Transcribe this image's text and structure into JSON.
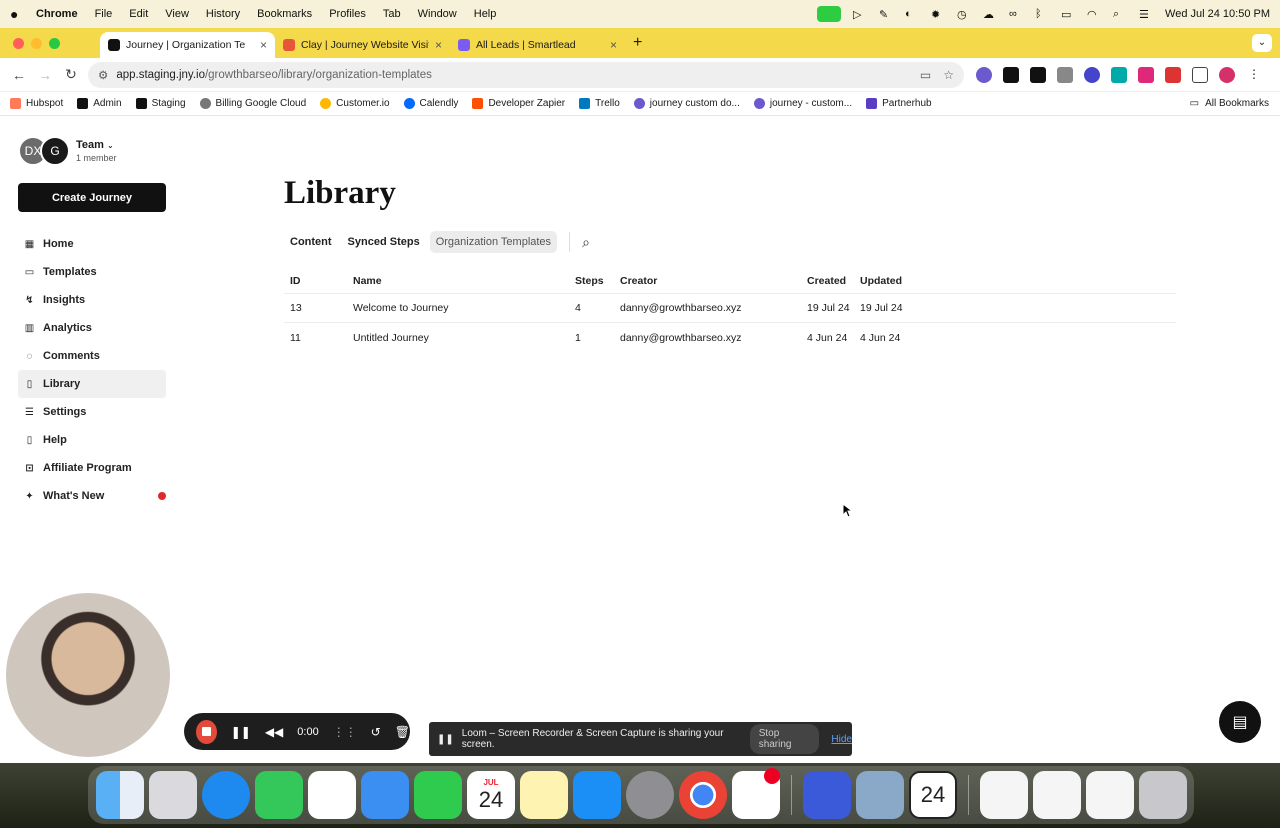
{
  "menubar": {
    "app": "Chrome",
    "items": [
      "File",
      "Edit",
      "View",
      "History",
      "Bookmarks",
      "Profiles",
      "Tab",
      "Window",
      "Help"
    ],
    "clock": "Wed Jul 24  10:50 PM"
  },
  "tabs": [
    {
      "title": "Journey | Organization Te",
      "color": "#111111"
    },
    {
      "title": "Clay | Journey Website Visitor",
      "color": "#e8563a"
    },
    {
      "title": "All Leads | Smartlead",
      "color": "#7b5cf0"
    }
  ],
  "address": {
    "host": "app.staging.jny.io",
    "path": "/growthbarseo/library/organization-templates"
  },
  "bookmarks": [
    {
      "label": "Hubspot",
      "color": "#ff7a59"
    },
    {
      "label": "Admin",
      "color": "#111111"
    },
    {
      "label": "Staging",
      "color": "#111111"
    },
    {
      "label": "Billing Google Cloud",
      "color": "#777777"
    },
    {
      "label": "Customer.io",
      "color": "#ffb800"
    },
    {
      "label": "Calendly",
      "color": "#006bff"
    },
    {
      "label": "Developer Zapier",
      "color": "#ff4f00"
    },
    {
      "label": "Trello",
      "color": "#0079bf"
    },
    {
      "label": "journey custom do...",
      "color": "#6a5acd"
    },
    {
      "label": "journey - custom...",
      "color": "#6a5acd"
    },
    {
      "label": "Partnerhub",
      "color": "#5b3cc4"
    }
  ],
  "all_bookmarks": "All Bookmarks",
  "team": {
    "avatar1": "DX",
    "avatar2": "G",
    "name": "Team",
    "members": "1 member"
  },
  "create_button": "Create Journey",
  "nav": [
    {
      "label": "Home",
      "icon": "grid-icon",
      "glyph": "▦"
    },
    {
      "label": "Templates",
      "icon": "templates-icon",
      "glyph": "▭"
    },
    {
      "label": "Insights",
      "icon": "insights-icon",
      "glyph": "↯"
    },
    {
      "label": "Analytics",
      "icon": "analytics-icon",
      "glyph": "▥"
    },
    {
      "label": "Comments",
      "icon": "comment-icon",
      "glyph": "◌"
    },
    {
      "label": "Library",
      "icon": "book-icon",
      "glyph": "▯"
    },
    {
      "label": "Settings",
      "icon": "settings-icon",
      "glyph": "☰"
    },
    {
      "label": "Help",
      "icon": "help-icon",
      "glyph": "▯"
    },
    {
      "label": "Affiliate Program",
      "icon": "affiliate-icon",
      "glyph": "⊡"
    },
    {
      "label": "What's New",
      "icon": "sparkle-icon",
      "glyph": "✦"
    }
  ],
  "page": {
    "title": "Library",
    "tabs": [
      "Content",
      "Synced Steps",
      "Organization Templates"
    ],
    "active_tab": "Organization Templates"
  },
  "table": {
    "columns": [
      "ID",
      "Name",
      "Steps",
      "Creator",
      "Created",
      "Updated"
    ],
    "rows": [
      [
        "13",
        "Welcome to Journey",
        "4",
        "danny@growthbarseo.xyz",
        "19 Jul 24",
        "19 Jul 24"
      ],
      [
        "11",
        "Untitled Journey",
        "1",
        "danny@growthbarseo.xyz",
        "4 Jun 24",
        "4 Jun 24"
      ]
    ]
  },
  "recorder": {
    "time": "0:00"
  },
  "share_bar": {
    "message": "Loom – Screen Recorder & Screen Capture is sharing your screen.",
    "stop": "Stop sharing",
    "hide": "Hide"
  },
  "dock": {
    "calendar_month": "JUL",
    "calendar_day": "24",
    "calendar2_day": "24",
    "slack_badge": ""
  }
}
